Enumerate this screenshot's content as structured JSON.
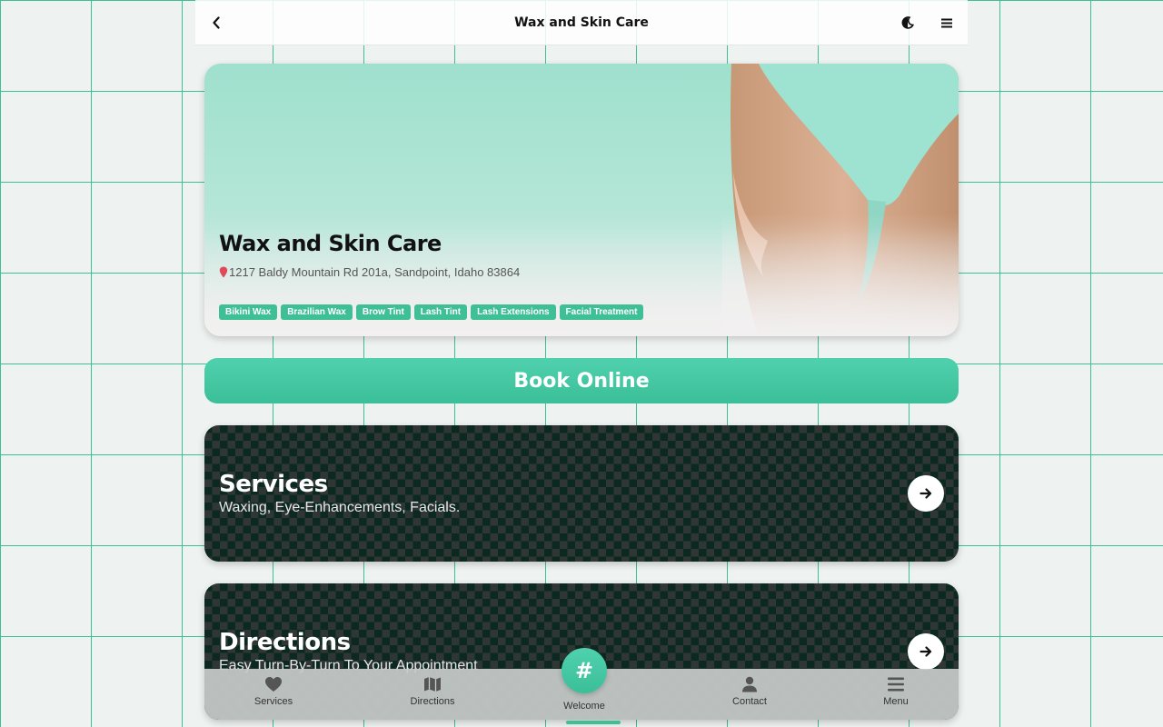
{
  "header": {
    "title": "Wax and Skin Care",
    "back_icon": "chevron-left-icon",
    "theme_icon": "moon-icon",
    "menu_icon": "hamburger-icon"
  },
  "hero": {
    "title": "Wax and Skin Care",
    "address": "1217 Baldy Mountain Rd 201a, Sandpoint, Idaho 83864",
    "pin_icon": "map-pin-icon",
    "tags": [
      "Bikini Wax",
      "Brazilian Wax",
      "Brow Tint",
      "Lash Tint",
      "Lash Extensions",
      "Facial Treatment"
    ]
  },
  "book_button": {
    "label": "Book Online"
  },
  "cards": [
    {
      "title": "Services",
      "subtitle": "Waxing, Eye-Enhancements, Facials."
    },
    {
      "title": "Directions",
      "subtitle": "Easy Turn-By-Turn To Your Appointment"
    }
  ],
  "bottom_nav": {
    "items": [
      {
        "label": "Services",
        "icon": "heart-icon"
      },
      {
        "label": "Directions",
        "icon": "map-icon"
      },
      {
        "label": "Contact",
        "icon": "user-icon"
      },
      {
        "label": "Menu",
        "icon": "hamburger-icon"
      }
    ],
    "center": {
      "label": "Welcome",
      "symbol": "#"
    }
  },
  "colors": {
    "accent": "#3fbf96",
    "grid": "#3fbf96",
    "card_dark": "#0d2a22",
    "pin": "#e0485c"
  }
}
